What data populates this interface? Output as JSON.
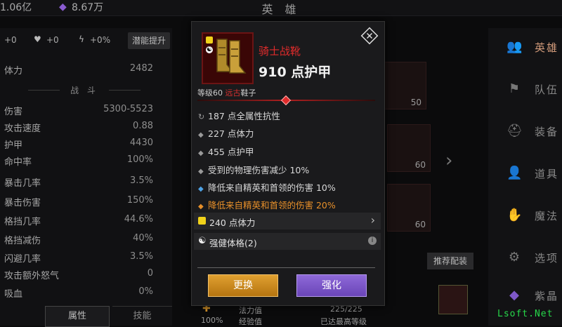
{
  "topbar": {
    "gold": "1.06亿",
    "gems": "8.67万",
    "title": "英 雄"
  },
  "left": {
    "bonus": [
      "+0",
      "+0",
      "+0%"
    ],
    "potential_button": "潜能提升",
    "stamina": {
      "label": "体力",
      "value": "2482"
    },
    "section": "战 斗",
    "stats": [
      {
        "label": "伤害",
        "value": "5300-5523"
      },
      {
        "label": "攻击速度",
        "value": "0.88"
      },
      {
        "label": "护甲",
        "value": "4430"
      },
      {
        "label": "命中率",
        "value": "100%"
      },
      {
        "label": "暴击几率",
        "value": "3.5%"
      },
      {
        "label": "暴击伤害",
        "value": "150%"
      },
      {
        "label": "格挡几率",
        "value": "44.6%"
      },
      {
        "label": "格挡减伤",
        "value": "40%"
      },
      {
        "label": "闪避几率",
        "value": "3.5%"
      },
      {
        "label": "攻击额外怒气",
        "value": "0"
      },
      {
        "label": "吸血",
        "value": "0%"
      }
    ],
    "tabs": [
      "属性",
      "技能"
    ]
  },
  "nav": [
    "英雄",
    "队伍",
    "装备",
    "道具",
    "魔法",
    "选项",
    "紫晶"
  ],
  "middle": {
    "slot_levels": [
      "50",
      "60",
      "60"
    ],
    "recommend": "推荐配装",
    "bottom": {
      "percent": "100%",
      "mana_label": "法力值",
      "exp_label": "经验值",
      "mana_value": "225/225",
      "exp_value": "已达最高等级"
    }
  },
  "tooltip": {
    "name": "骑士战靴",
    "main_stat": "910 点护甲",
    "level_prefix": "等级60",
    "level_rarity": "远古",
    "level_type": "鞋子",
    "affixes": [
      {
        "icon": "refresh-icon",
        "text": "187 点全属性抗性",
        "color": "#d8d8d8"
      },
      {
        "icon": "diamond-bullet-icon",
        "text": "227 点体力",
        "color": "#d8d8d8"
      },
      {
        "icon": "diamond-bullet-icon",
        "text": "455 点护甲",
        "color": "#d8d8d8"
      },
      {
        "icon": "diamond-bullet-icon",
        "text": "受到的物理伤害减少 10%",
        "color": "#d8d8d8"
      },
      {
        "icon": "blue-diamond-icon",
        "text": "降低来自精英和首领的伤害 10%",
        "color": "#d8d8d8"
      },
      {
        "icon": "orange-diamond-icon",
        "text": "降低来自精英和首领的伤害 20%",
        "color": "#e8902a"
      }
    ],
    "gem": "240 点体力",
    "set": "强健体格(2)",
    "buttons": {
      "swap": "更换",
      "upgrade": "强化"
    }
  },
  "watermark": "Lsoft.Net",
  "colors": {
    "rarity_red": "#e02b2b",
    "legendary_orange": "#e8902a",
    "swap_gold": "#d9962a",
    "upgrade_purple": "#7e58c8"
  }
}
